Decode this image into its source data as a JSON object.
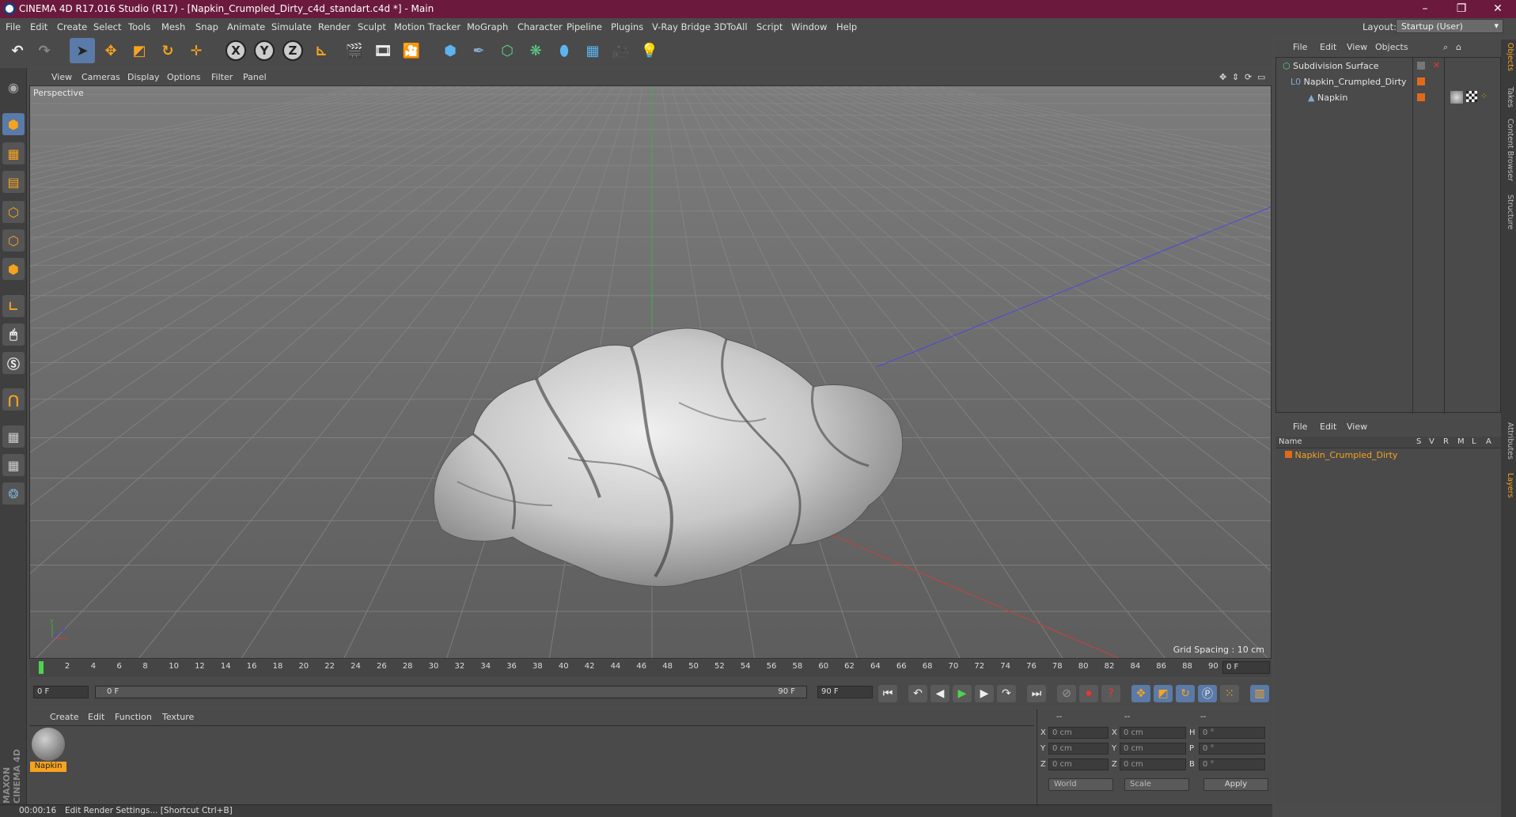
{
  "window": {
    "title": "CINEMA 4D R17.016 Studio (R17) - [Napkin_Crumpled_Dirty_c4d_standart.c4d *] - Main",
    "minimize": "–",
    "maximize": "❐",
    "close": "✕"
  },
  "menu": {
    "items": [
      "File",
      "Edit",
      "Create",
      "Select",
      "Tools",
      "Mesh",
      "Snap",
      "Animate",
      "Simulate",
      "Render",
      "Sculpt",
      "Motion Tracker",
      "MoGraph",
      "Character",
      "Pipeline",
      "Plugins",
      "V-Ray Bridge",
      "3DToAll",
      "Script",
      "Window",
      "Help"
    ],
    "layout_label": "Layout:",
    "layout_value": "Startup (User)"
  },
  "toolbar": {
    "undo": "↶",
    "redo": "↷",
    "x_axis": "X",
    "y_axis": "Y",
    "z_axis": "Z"
  },
  "viewport": {
    "menu": [
      "View",
      "Cameras",
      "Display",
      "Options",
      "Filter",
      "Panel"
    ],
    "label": "Perspective",
    "grid_spacing": "Grid Spacing : 10 cm"
  },
  "timeline": {
    "ticks": [
      "0",
      "2",
      "4",
      "6",
      "8",
      "10",
      "12",
      "14",
      "16",
      "18",
      "20",
      "22",
      "24",
      "26",
      "28",
      "30",
      "32",
      "34",
      "36",
      "38",
      "40",
      "42",
      "44",
      "46",
      "48",
      "50",
      "52",
      "54",
      "56",
      "58",
      "60",
      "62",
      "64",
      "66",
      "68",
      "70",
      "72",
      "74",
      "76",
      "78",
      "80",
      "82",
      "84",
      "86",
      "88",
      "90"
    ],
    "current_frame": "0 F",
    "start_field": "0 F",
    "range_start": "0 F",
    "range_end": "90 F",
    "end_field": "90 F"
  },
  "material_manager": {
    "menu": [
      "Create",
      "Edit",
      "Function",
      "Texture"
    ],
    "material_name": "Napkin"
  },
  "coordinates": {
    "header": [
      "--",
      "--",
      "--"
    ],
    "rows": [
      {
        "axis": "X",
        "pos": "0 cm",
        "axis2": "X",
        "size": "0 cm",
        "rot_axis": "H",
        "rot": "0 °"
      },
      {
        "axis": "Y",
        "pos": "0 cm",
        "axis2": "Y",
        "size": "0 cm",
        "rot_axis": "P",
        "rot": "0 °"
      },
      {
        "axis": "Z",
        "pos": "0 cm",
        "axis2": "Z",
        "size": "0 cm",
        "rot_axis": "B",
        "rot": "0 °"
      }
    ],
    "mode1": "World",
    "mode2": "Scale",
    "apply": "Apply"
  },
  "status": {
    "time": "00:00:16",
    "message": "Edit Render Settings... [Shortcut Ctrl+B]"
  },
  "objects_panel": {
    "menu": [
      "File",
      "Edit",
      "View",
      "Objects"
    ],
    "items": [
      "Subdivision Surface",
      "Napkin_Crumpled_Dirty",
      "Napkin"
    ]
  },
  "layers_panel": {
    "menu": [
      "File",
      "Edit",
      "View"
    ],
    "headers": [
      "Name",
      "S",
      "V",
      "R",
      "M",
      "L",
      "A"
    ],
    "items": [
      "Napkin_Crumpled_Dirty"
    ]
  },
  "side_tabs": [
    "Objects",
    "Takes",
    "Content Browser",
    "Structure",
    "Attributes",
    "Layers"
  ],
  "brand": "MAXON CINEMA 4D",
  "colors": {
    "title_bg": "#6b1a3d",
    "accent": "#f6a320",
    "selection": "#5a7aa8"
  }
}
